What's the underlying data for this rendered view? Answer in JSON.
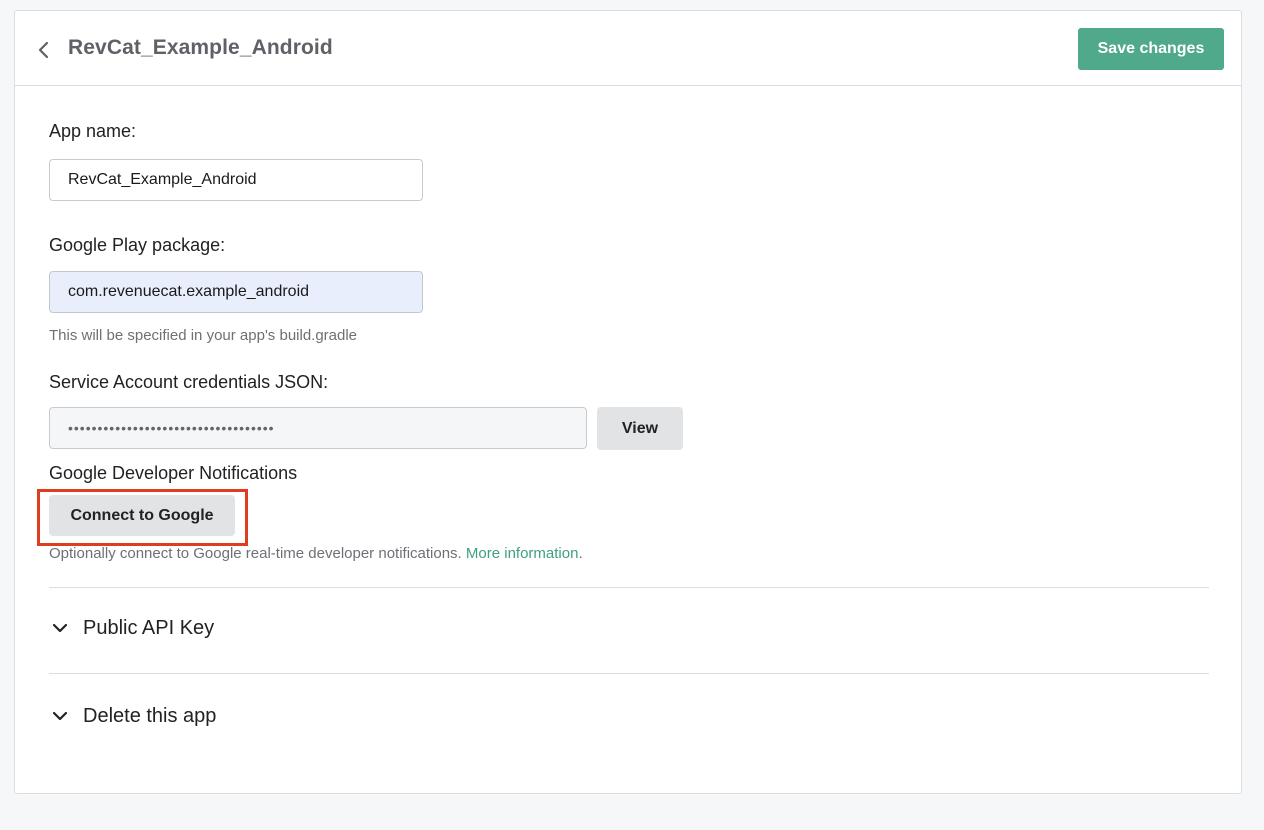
{
  "header": {
    "title": "RevCat_Example_Android",
    "save_label": "Save changes"
  },
  "form": {
    "app_name_label": "App name:",
    "app_name_value": "RevCat_Example_Android",
    "package_label": "Google Play package:",
    "package_value": "com.revenuecat.example_android",
    "package_hint": "This will be specified in your app's build.gradle",
    "credentials_label": "Service Account credentials JSON:",
    "credentials_value": "•••••••••••••••••••••••••••••••••••",
    "view_label": "View",
    "notifications_label": "Google Developer Notifications",
    "connect_label": "Connect to Google",
    "notifications_hint": "Optionally connect to Google real-time developer notifications.",
    "more_info_link": "More information",
    "hint_end": "."
  },
  "sections": {
    "public_api_key": "Public API Key",
    "delete_app": "Delete this app"
  },
  "colors": {
    "accent": "#4fa98a",
    "link": "#3f9f7f",
    "highlight": "#e03c1f"
  }
}
